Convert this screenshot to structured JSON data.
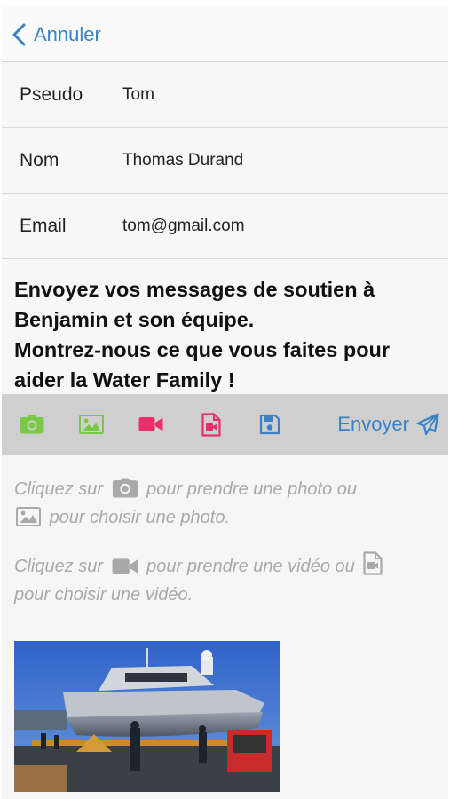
{
  "nav": {
    "back_label": "Annuler",
    "accent": "#3b82c4"
  },
  "form": {
    "fields": [
      {
        "label": "Pseudo",
        "value": "Tom"
      },
      {
        "label": "Nom",
        "value": "Thomas Durand"
      },
      {
        "label": "Email",
        "value": "tom@gmail.com"
      }
    ]
  },
  "message": {
    "lines": [
      "Envoyez vos messages de soutien à",
      "Benjamin et son équipe.",
      "Montrez-nous ce que vous faites pour",
      "aider la Water Family !"
    ]
  },
  "toolbar": {
    "icons": [
      "camera-icon",
      "image-icon",
      "video-camera-icon",
      "video-file-icon",
      "save-icon"
    ],
    "colors": {
      "photo": "#7ac943",
      "video": "#ec2f6b",
      "save": "#3b82c4"
    },
    "send_label": "Envoyer"
  },
  "help": {
    "photo_part1": "Cliquez sur",
    "photo_part2": "pour prendre une photo ou",
    "photo_part3": "pour choisir une photo.",
    "video_part1": "Cliquez sur",
    "video_part2": "pour prendre une vidéo ou",
    "video_part3": "pour choisir une vidéo."
  },
  "attachment": {
    "type": "photo",
    "subject": "boat on shipyard trailer"
  }
}
